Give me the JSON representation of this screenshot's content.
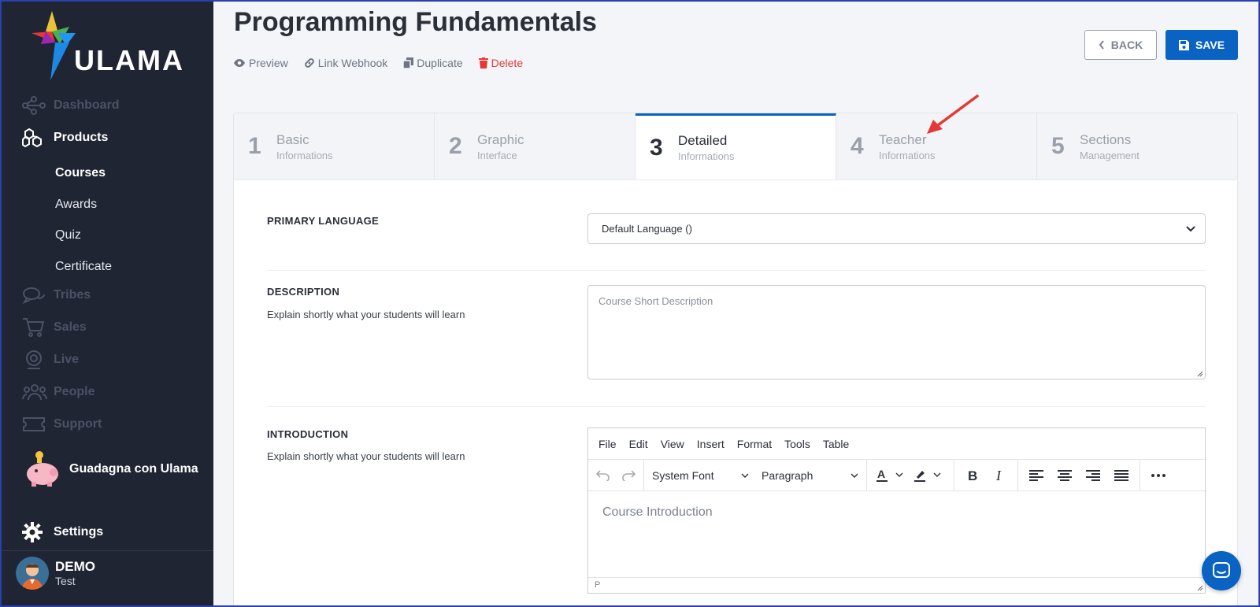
{
  "sidebar": {
    "brand": "ULAMA",
    "nav": {
      "dashboard": "Dashboard",
      "products": "Products",
      "tribes": "Tribes",
      "sales": "Sales",
      "live": "Live",
      "people": "People",
      "support": "Support",
      "settings": "Settings"
    },
    "products_sub": [
      "Courses",
      "Awards",
      "Quiz",
      "Certificate"
    ],
    "promo": "Guadagna con Ulama",
    "user": {
      "name": "DEMO",
      "sub": "Test"
    }
  },
  "header": {
    "title": "Programming Fundamentals",
    "actions": {
      "preview": "Preview",
      "webhook": "Link Webhook",
      "duplicate": "Duplicate",
      "delete": "Delete"
    },
    "back_label": "BACK",
    "save_label": "SAVE"
  },
  "steps": [
    {
      "num": "1",
      "title": "Basic",
      "sub": "Informations"
    },
    {
      "num": "2",
      "title": "Graphic",
      "sub": "Interface"
    },
    {
      "num": "3",
      "title": "Detailed",
      "sub": "Informations"
    },
    {
      "num": "4",
      "title": "Teacher",
      "sub": "Informations"
    },
    {
      "num": "5",
      "title": "Sections",
      "sub": "Management"
    }
  ],
  "form": {
    "primary_language": {
      "label": "PRIMARY LANGUAGE",
      "value": "Default Language ()"
    },
    "description": {
      "label": "DESCRIPTION",
      "help": "Explain shortly what your students will learn",
      "placeholder": "Course Short Description"
    },
    "introduction": {
      "label": "INTRODUCTION",
      "help": "Explain shortly what your students will learn"
    }
  },
  "editor": {
    "menu": [
      "File",
      "Edit",
      "View",
      "Insert",
      "Format",
      "Tools",
      "Table"
    ],
    "font": "System Font",
    "block": "Paragraph",
    "placeholder": "Course Introduction",
    "path": "P"
  },
  "colors": {
    "accent": "#0a63c2",
    "sidebar_bg": "#1f2533",
    "danger": "#e53935",
    "annotation_arrow": "#e53935"
  }
}
